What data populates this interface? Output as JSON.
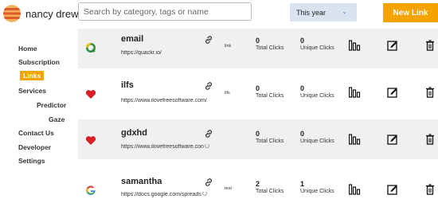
{
  "user": {
    "name": "nancy drew"
  },
  "search": {
    "placeholder": "Search by category, tags or name"
  },
  "period": {
    "selected": "This year"
  },
  "new_link_label": "New Link",
  "nav": [
    {
      "label": "Home",
      "active": false
    },
    {
      "label": "Subscription",
      "active": false
    },
    {
      "label": "Links",
      "active": true
    },
    {
      "label": "Services",
      "active": false
    },
    {
      "label": "Predictor",
      "active": false
    },
    {
      "label": "Gaze",
      "active": false
    },
    {
      "label": "Contact Us",
      "active": false
    },
    {
      "label": "Developer",
      "active": false
    },
    {
      "label": "Settings",
      "active": false
    }
  ],
  "columns": {
    "total_clicks": "Total Clicks",
    "unique_clicks": "Unique Clicks"
  },
  "links": [
    {
      "name": "email",
      "url": "https://quackr.io/",
      "tag": "link",
      "total": "0",
      "unique": "0",
      "icon": "quackr-icon"
    },
    {
      "name": "ilfs",
      "url": "https://www.ilovefreesoftware.com/",
      "tag": "ilfs",
      "total": "0",
      "unique": "0",
      "icon": "heart-icon"
    },
    {
      "name": "gdxhd",
      "url": "https://www.ilovefreesoftware.con",
      "tag": "",
      "total": "0",
      "unique": "0",
      "icon": "heart-icon"
    },
    {
      "name": "samantha",
      "url": "https://docs.google.com/spreads",
      "tag": "test",
      "total": "2",
      "unique": "1",
      "icon": "google-icon"
    }
  ],
  "colors": {
    "accent": "#f5a300",
    "row_alt": "#f0f0f0",
    "select_bg": "#d9e4f0"
  }
}
